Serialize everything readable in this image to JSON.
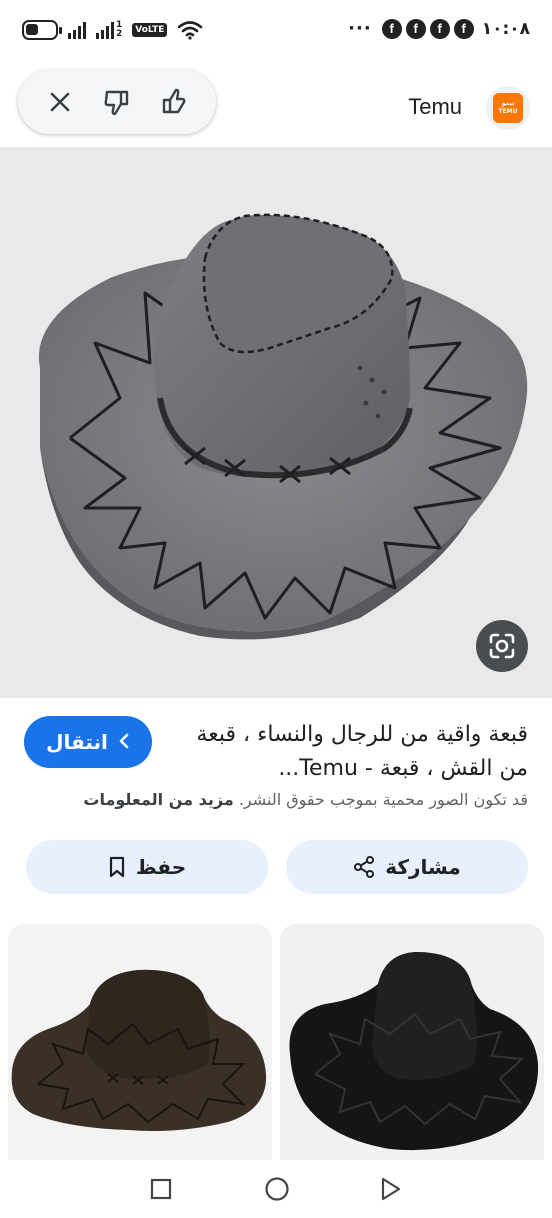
{
  "status_bar": {
    "time": "١٠:٠٨",
    "overflow": "···",
    "notification_icons": [
      "f",
      "f",
      "f",
      "f"
    ],
    "volte": "VoLTE",
    "sim2_labels": [
      "1",
      "2"
    ]
  },
  "header": {
    "site_name": "Temu",
    "logo_text_top": "تيمو",
    "logo_text_bottom": "TEMU",
    "brand_color": "#fb7701"
  },
  "result": {
    "title": "قبعة واقية من للرجال والنساء ، قبعة من القش ، قبعة - Temu...",
    "go_button_label": "انتقال",
    "copyright_notice": "قد تكون الصور محمية بموجب حقوق النشر.",
    "learn_more": "مزيد من المعلومات",
    "share_label": "مشاركة",
    "save_label": "حفظ",
    "accent_color": "#1a73e8"
  },
  "main_image": {
    "alt": "gray cowboy hat"
  },
  "related": [
    {
      "alt": "brown cowboy hat"
    },
    {
      "alt": "black cowboy hat"
    }
  ]
}
